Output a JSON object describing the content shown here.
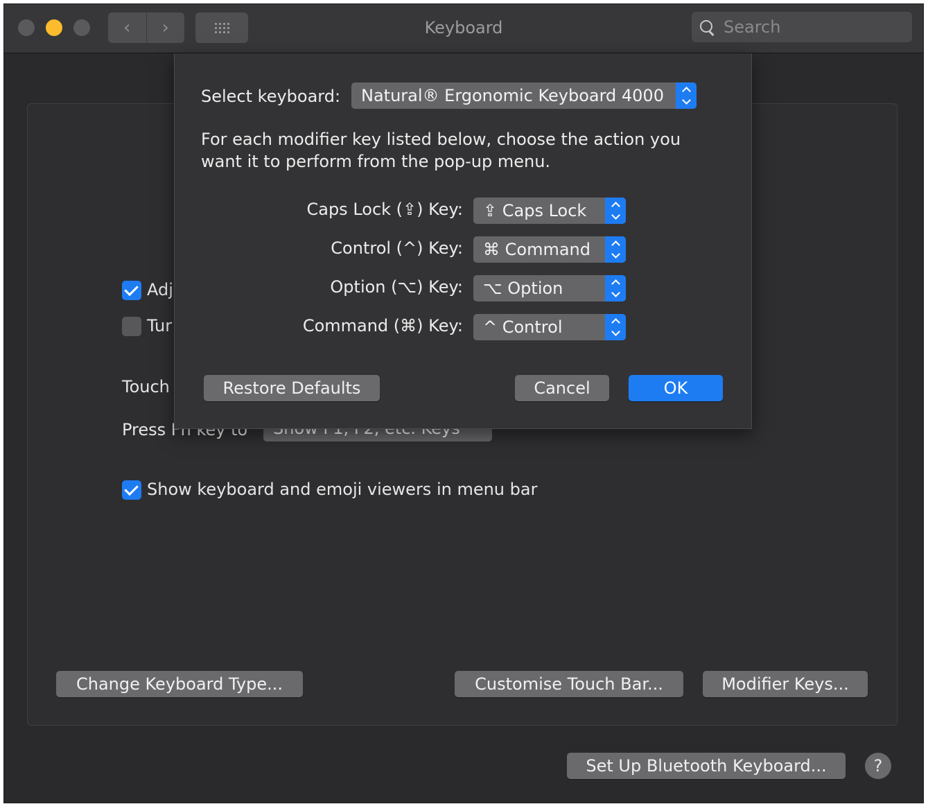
{
  "window": {
    "title": "Keyboard",
    "search_placeholder": "Search",
    "nav": {
      "back": "‹",
      "forward": "›"
    }
  },
  "background": {
    "checkboxes": [
      {
        "label": "Adj",
        "checked": true
      },
      {
        "label": "Tur",
        "checked": false
      }
    ],
    "touch_label": "Touch",
    "press_label": "Press Fn key to",
    "press_popup": "Show F1, F2, etc. Keys",
    "emoji_checkbox": {
      "label": "Show keyboard and emoji viewers in menu bar",
      "checked": true
    },
    "buttons": {
      "change_type": "Change Keyboard Type...",
      "customise_touch_bar": "Customise Touch Bar...",
      "modifier_keys": "Modifier Keys...",
      "bluetooth": "Set Up Bluetooth Keyboard...",
      "help": "?"
    }
  },
  "sheet": {
    "select_keyboard_label": "Select keyboard:",
    "selected_keyboard": "Natural® Ergonomic Keyboard 4000",
    "instructions": "For each modifier key listed below, choose the action you want it to perform from the pop-up menu.",
    "modifiers": [
      {
        "label": "Caps Lock (⇪) Key:",
        "value": "⇪ Caps Lock"
      },
      {
        "label": "Control (^) Key:",
        "value": "⌘ Command"
      },
      {
        "label": "Option (⌥) Key:",
        "value": "⌥ Option"
      },
      {
        "label": "Command (⌘) Key:",
        "value": "^ Control"
      }
    ],
    "buttons": {
      "restore_defaults": "Restore Defaults",
      "cancel": "Cancel",
      "ok": "OK"
    }
  },
  "colors": {
    "accent": "#1e7cf3",
    "traffic_yellow": "#fdbc2d"
  }
}
